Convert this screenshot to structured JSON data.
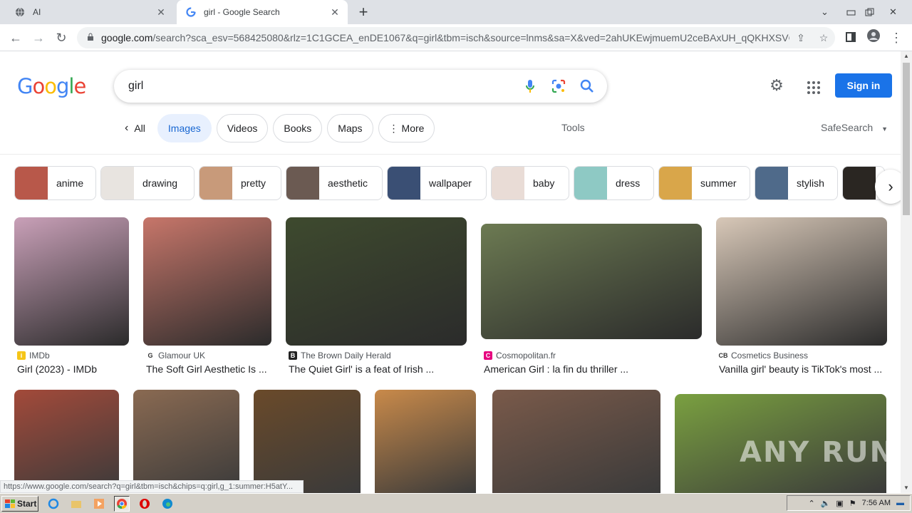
{
  "browser": {
    "tabs": [
      {
        "title": "AI",
        "icon": "globe-icon"
      },
      {
        "title": "girl - Google Search",
        "icon": "google-g-icon"
      }
    ],
    "url_host": "google.com",
    "url_rest": "/search?sca_esv=568425080&rlz=1C1GCEA_enDE1067&q=girl&tbm=isch&source=lnms&sa=X&ved=2ahUKEwjmuemU2ceBAxUH_qQKHXSVC...",
    "status_url": "https://www.google.com/search?q=girl&tbm=isch&chips=q:girl,g_1:summer:H5atY..."
  },
  "google": {
    "logo_letters": [
      "G",
      "o",
      "o",
      "g",
      "l",
      "e"
    ],
    "logo_colors": [
      "#4285f4",
      "#ea4335",
      "#fbbc05",
      "#4285f4",
      "#34a853",
      "#ea4335"
    ],
    "query": "girl",
    "signin_label": "Sign in",
    "tabs": {
      "all": "All",
      "images": "Images",
      "videos": "Videos",
      "books": "Books",
      "maps": "Maps",
      "more": "More"
    },
    "tools_label": "Tools",
    "safesearch_label": "SafeSearch"
  },
  "chips": [
    {
      "label": "anime",
      "color": "#b8584a"
    },
    {
      "label": "drawing",
      "color": "#e8e4e0"
    },
    {
      "label": "pretty",
      "color": "#c89a7a"
    },
    {
      "label": "aesthetic",
      "color": "#6b5a52"
    },
    {
      "label": "wallpaper",
      "color": "#3a4f74"
    },
    {
      "label": "baby",
      "color": "#e9dcd6"
    },
    {
      "label": "dress",
      "color": "#8ec9c4"
    },
    {
      "label": "summer",
      "color": "#d9a64a"
    },
    {
      "label": "stylish",
      "color": "#4f6a8a"
    },
    {
      "label": "",
      "color": "#2a2622"
    }
  ],
  "results_row1": [
    {
      "source": "IMDb",
      "title": "Girl (2023) - IMDb",
      "bg": "#c9a0b8",
      "icon_bg": "#f5c518",
      "icon_txt": "i"
    },
    {
      "source": "Glamour UK",
      "title": "The Soft Girl Aesthetic Is ...",
      "bg": "#c7766a",
      "icon_bg": "#fff",
      "icon_txt": "G"
    },
    {
      "source": "The Brown Daily Herald",
      "title": "The Quiet Girl' is a feat of Irish ...",
      "bg": "#3e4a2e",
      "icon_bg": "#222",
      "icon_txt": "B"
    },
    {
      "source": "Cosmopolitan.fr",
      "title": "American Girl : la fin du thriller ...",
      "bg": "#6c7a52",
      "icon_bg": "#e6007e",
      "icon_txt": "C"
    },
    {
      "source": "Cosmetics Business",
      "title": "Vanilla girl' beauty is TikTok's most ...",
      "bg": "#d8c8b8",
      "icon_bg": "#fff",
      "icon_txt": "CB"
    }
  ],
  "results_row2_colors": [
    "#a34a3a",
    "#8a6a52",
    "#6a4a2a",
    "#c98a4a",
    "#7a5a4a",
    "#7aa040"
  ],
  "taskbar": {
    "start_label": "Start",
    "clock": "7:56 AM"
  },
  "watermark": "ANY RUN"
}
